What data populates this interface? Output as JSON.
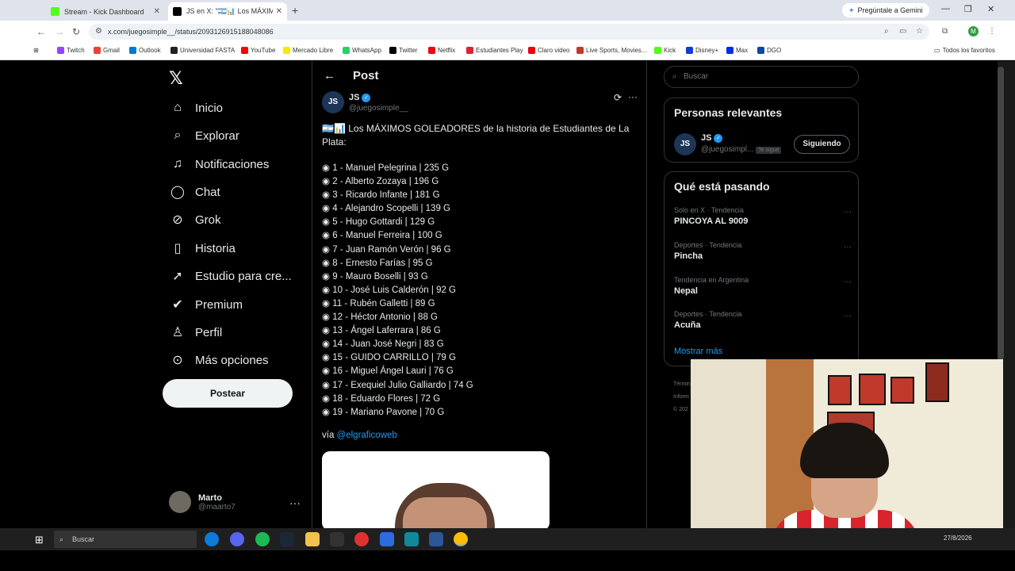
{
  "browser": {
    "tabs": [
      {
        "label": "Stream - Kick Dashboard",
        "favicon_color": "#53fc18"
      },
      {
        "label": "JS en X: \"🇦🇷📊 Los MÁXIMOS G",
        "favicon_color": "#000000"
      }
    ],
    "new_tab_icon": "plus-icon",
    "gemini_label": "Pregúntale a Gemini",
    "url": "x.com/juegosimple__/status/2093126915188048086",
    "bookmarks": [
      {
        "label": "Twitch",
        "color": "#9146ff"
      },
      {
        "label": "Gmail",
        "color": "#ea4335"
      },
      {
        "label": "Outlook",
        "color": "#0078d4"
      },
      {
        "label": "Universidad FASTA",
        "color": "#222222"
      },
      {
        "label": "YouTube",
        "color": "#ff0000"
      },
      {
        "label": "Mercado Libre",
        "color": "#ffe600"
      },
      {
        "label": "WhatsApp",
        "color": "#25d366"
      },
      {
        "label": "Twitter",
        "color": "#000000"
      },
      {
        "label": "Netflix",
        "color": "#e50914"
      },
      {
        "label": "Estudiantes Play",
        "color": "#d9232d"
      },
      {
        "label": "Claro video",
        "color": "#e30613"
      },
      {
        "label": "Live Sports, Movies...",
        "color": "#c0392b"
      },
      {
        "label": "Kick",
        "color": "#53fc18"
      },
      {
        "label": "Disney+",
        "color": "#113ccf"
      },
      {
        "label": "Max",
        "color": "#002be7"
      },
      {
        "label": "DGO",
        "color": "#0d47a1"
      }
    ],
    "all_favorites": "Todos los favoritos",
    "profile_initial": "M"
  },
  "nav": {
    "items": [
      {
        "label": "Inicio",
        "icon": "home-icon"
      },
      {
        "label": "Explorar",
        "icon": "search-icon"
      },
      {
        "label": "Notificaciones",
        "icon": "bell-icon"
      },
      {
        "label": "Chat",
        "icon": "chat-icon"
      },
      {
        "label": "Grok",
        "icon": "grok-icon"
      },
      {
        "label": "Historia",
        "icon": "bookmark-icon"
      },
      {
        "label": "Estudio para cre...",
        "icon": "rocket-icon"
      },
      {
        "label": "Premium",
        "icon": "verified-icon"
      },
      {
        "label": "Perfil",
        "icon": "user-icon"
      },
      {
        "label": "Más opciones",
        "icon": "more-circle-icon"
      }
    ],
    "post_button": "Postear",
    "user": {
      "name": "Marto",
      "handle": "@maarto7"
    }
  },
  "post": {
    "header_title": "Post",
    "author_name": "JS",
    "author_initials": "JS",
    "author_handle": "@juegosimple__",
    "intro": "🇦🇷📊 Los MÁXIMOS GOLEADORES de la historia de Estudiantes de La Plata:",
    "scorers": [
      "1 - Manuel Pelegrina | 235 G",
      "2 - Alberto Zozaya | 196 G",
      "3 - Ricardo Infante | 181 G",
      "4 - Alejandro Scopelli | 139 G",
      "5 - Hugo Gottardi | 129 G",
      "6 - Manuel Ferreira | 100 G",
      "7 - Juan Ramón Verón | 96 G",
      "8 - Ernesto Farías | 95 G",
      "9 - Mauro Boselli | 93 G",
      "10 - José Luis Calderón | 92 G",
      "11 - Rubén Galletti | 89 G",
      "12 - Héctor Antonio | 88 G",
      "13 - Ángel Laferrara | 86 G",
      "14 - Juan José Negri | 83 G",
      "15 - GUIDO CARRILLO | 79 G",
      "16 - Miguel Ángel Lauri | 76 G",
      "17 - Exequiel Julio Galliardo | 74 G",
      "18 - Eduardo Flores | 72 G",
      "19 - Mariano Pavone | 70 G"
    ],
    "via_prefix": "vía",
    "via_handle": "@elgraficoweb"
  },
  "sidebar": {
    "search_placeholder": "Buscar",
    "relevant_title": "Personas relevantes",
    "relevant": {
      "name": "JS",
      "initials": "JS",
      "handle": "@juegosimpl...",
      "badge": "Te sigue",
      "button": "Siguiendo"
    },
    "trending_title": "Qué está pasando",
    "trends": [
      {
        "context": "Solo en X · Tendencia",
        "title": "PINCOYA AL 9009"
      },
      {
        "context": "Deportes · Tendencia",
        "title": "Pincha"
      },
      {
        "context": "Tendencia en Argentina",
        "title": "Nepal"
      },
      {
        "context": "Deportes · Tendencia",
        "title": "Acuña"
      }
    ],
    "show_more": "Mostrar más",
    "footer_lines": [
      "Términ",
      "Inform",
      "© 202"
    ]
  },
  "taskbar": {
    "search_label": "Buscar",
    "clock": "27/8/2026"
  },
  "colors": {
    "accent": "#1d9bf0",
    "bg": "#000000",
    "text": "#e7e9ea",
    "muted": "#71767b"
  }
}
